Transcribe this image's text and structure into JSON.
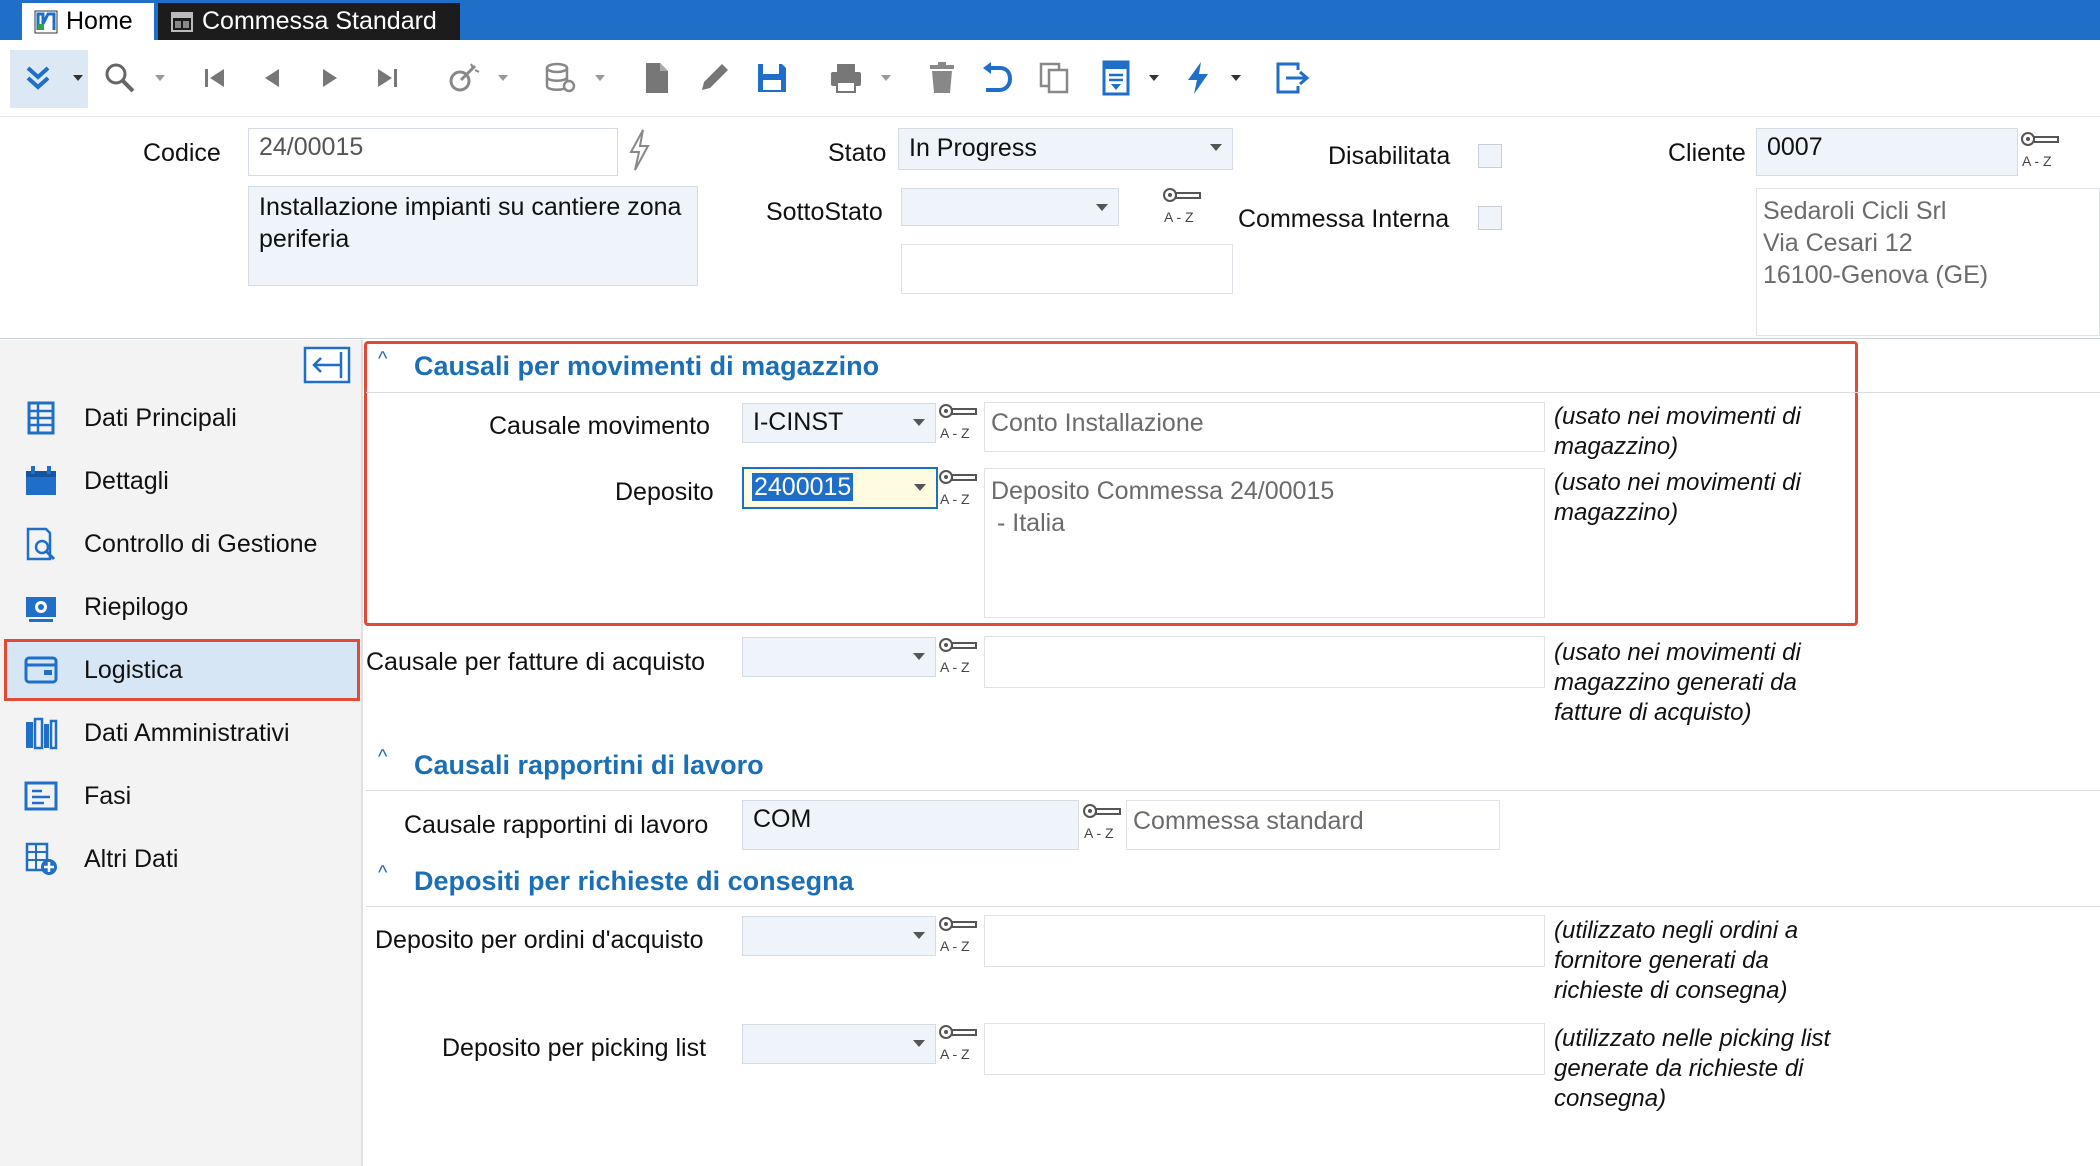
{
  "titlebar": {
    "tabs": [
      {
        "label": "Home",
        "icon": "app-logo-icon"
      },
      {
        "label": "Commessa Standard",
        "icon": "window-icon"
      }
    ],
    "bg_color": "#1f6fc9"
  },
  "header": {
    "codice_label": "Codice",
    "codice_value": "24/00015",
    "description": "Installazione impianti su cantiere zona periferia",
    "stato_label": "Stato",
    "stato_value": "In Progress",
    "sottostato_label": "SottoStato",
    "sottostato_value": "",
    "disabilitata_label": "Disabilitata",
    "commessa_interna_label": "Commessa Interna",
    "cliente_label": "Cliente",
    "cliente_value": "0007",
    "cliente_name": "Sedaroli Cicli Srl",
    "cliente_address": "Via Cesari 12",
    "cliente_city": "16100-Genova (GE)"
  },
  "sidebar": {
    "items": [
      {
        "label": "Dati Principali",
        "icon": "spreadsheet-icon"
      },
      {
        "label": "Dettagli",
        "icon": "calendar-icon"
      },
      {
        "label": "Controllo di Gestione",
        "icon": "document-search-icon"
      },
      {
        "label": "Riepilogo",
        "icon": "money-icon"
      },
      {
        "label": "Logistica",
        "icon": "wallet-icon",
        "selected": true
      },
      {
        "label": "Dati Amministrativi",
        "icon": "books-icon"
      },
      {
        "label": "Fasi",
        "icon": "list-icon"
      },
      {
        "label": "Altri Dati",
        "icon": "add-table-icon"
      }
    ]
  },
  "main": {
    "section1": {
      "title": "Causali per movimenti di magazzino",
      "causale_movimento_label": "Causale movimento",
      "causale_movimento_value": "I-CINST",
      "causale_movimento_desc": "Conto Installazione",
      "causale_movimento_note": "(usato nei movimenti di magazzino)",
      "deposito_label": "Deposito",
      "deposito_value": "2400015",
      "deposito_desc_line1": "Deposito Commessa 24/00015",
      "deposito_desc_line2": "- Italia",
      "deposito_note": "(usato nei movimenti di magazzino)",
      "fatture_label": "Causale per fatture di acquisto",
      "fatture_value": "",
      "fatture_note": "(usato nei movimenti di magazzino generati da fatture di acquisto)"
    },
    "section2": {
      "title": "Causali rapportini di lavoro",
      "rapportini_label": "Causale rapportini di lavoro",
      "rapportini_value": "COM",
      "rapportini_desc": "Commessa standard"
    },
    "section3": {
      "title": "Depositi per richieste di consegna",
      "ordini_label": "Deposito per ordini d'acquisto",
      "ordini_value": "",
      "ordini_note": "(utilizzato negli ordini a fornitore generati da richieste di consegna)",
      "picking_label": "Deposito per picking list",
      "picking_value": "",
      "picking_note": "(utilizzato nelle picking list generate da richieste di consegna)"
    }
  },
  "colors": {
    "accent": "#1b6fb6",
    "highlight": "#e24a35",
    "field_bg": "#eef4fa",
    "sidebar_selected": "#d6e6f5"
  }
}
